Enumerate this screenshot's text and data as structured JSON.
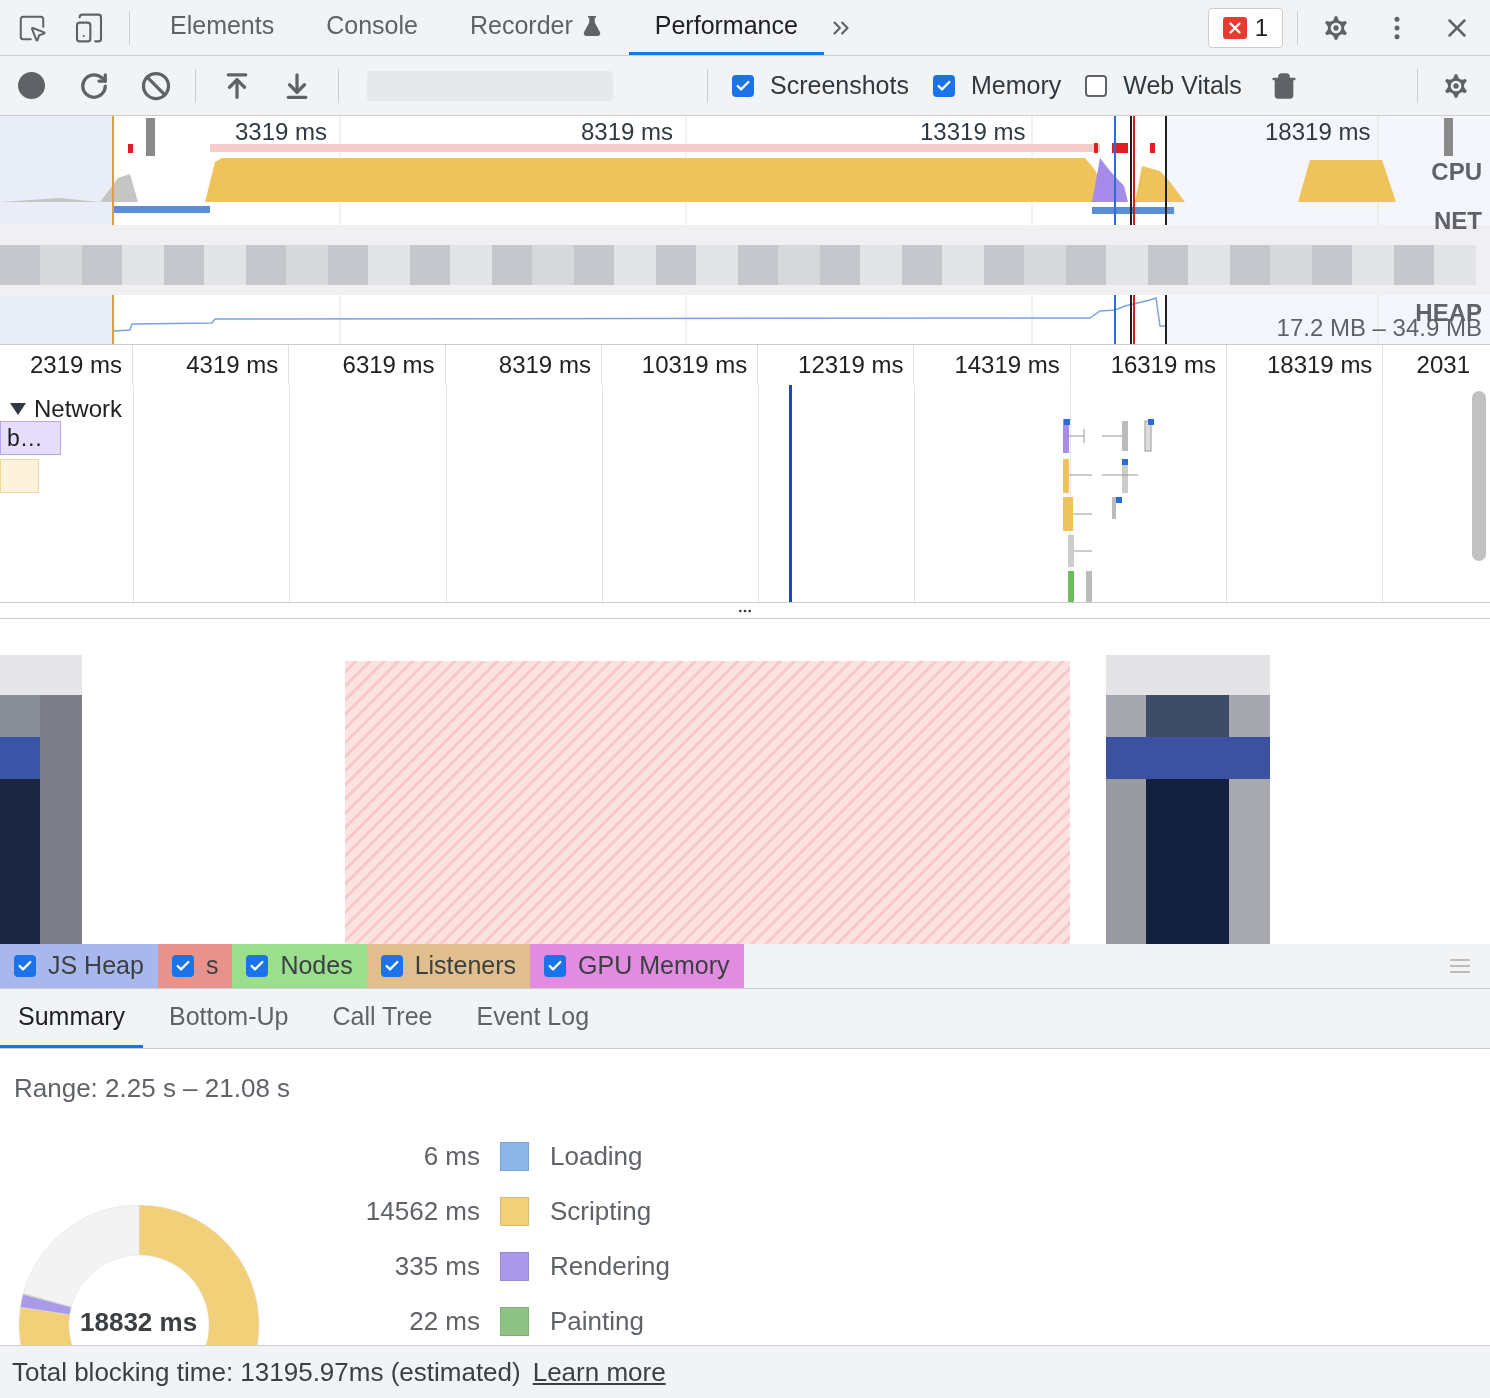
{
  "tabs": [
    {
      "label": "Elements",
      "selected": false,
      "kind": "plain"
    },
    {
      "label": "Console",
      "selected": false,
      "kind": "plain"
    },
    {
      "label": "Recorder",
      "selected": false,
      "kind": "experimental"
    },
    {
      "label": "Performance",
      "selected": true,
      "kind": "plain"
    }
  ],
  "error_count": "1",
  "toolbar": {
    "checkboxes": [
      {
        "label": "Screenshots",
        "checked": true
      },
      {
        "label": "Memory",
        "checked": true
      },
      {
        "label": "Web Vitals",
        "checked": false
      }
    ]
  },
  "overview": {
    "ticks": [
      "3319 ms",
      "8319 ms",
      "13319 ms",
      "18319 ms"
    ],
    "tracks": [
      "CPU",
      "NET",
      "HEAP"
    ],
    "heap_range": "17.2 MB – 34.9 MB"
  },
  "ruler": [
    "2319 ms",
    "4319 ms",
    "6319 ms",
    "8319 ms",
    "10319 ms",
    "12319 ms",
    "14319 ms",
    "16319 ms",
    "18319 ms",
    "2031"
  ],
  "network": {
    "title": "Network",
    "expanded": true,
    "items": [
      {
        "label": "b…"
      }
    ]
  },
  "memory_legend": [
    {
      "label": "JS Heap",
      "checked": true,
      "color": "#a9b8ec"
    },
    {
      "label": "s",
      "checked": true,
      "color": "#e8928c"
    },
    {
      "label": "Nodes",
      "checked": true,
      "color": "#9ade8e"
    },
    {
      "label": "Listeners",
      "checked": true,
      "color": "#e1be8e"
    },
    {
      "label": "GPU Memory",
      "checked": true,
      "color": "#e18ce1"
    }
  ],
  "details_tabs": [
    {
      "label": "Summary",
      "selected": true
    },
    {
      "label": "Bottom-Up",
      "selected": false
    },
    {
      "label": "Call Tree",
      "selected": false
    },
    {
      "label": "Event Log",
      "selected": false
    }
  ],
  "summary": {
    "range": "Range: 2.25 s – 21.08 s",
    "total": "18832 ms",
    "legend": [
      {
        "value": "6 ms",
        "label": "Loading",
        "color": "#8cb6e8"
      },
      {
        "value": "14562 ms",
        "label": "Scripting",
        "color": "#f2cf79"
      },
      {
        "value": "335 ms",
        "label": "Rendering",
        "color": "#ab9aea"
      },
      {
        "value": "22 ms",
        "label": "Painting",
        "color": "#8fc385"
      }
    ]
  },
  "footer": {
    "text": "Total blocking time: 13195.97ms (estimated)",
    "link": "Learn more"
  }
}
